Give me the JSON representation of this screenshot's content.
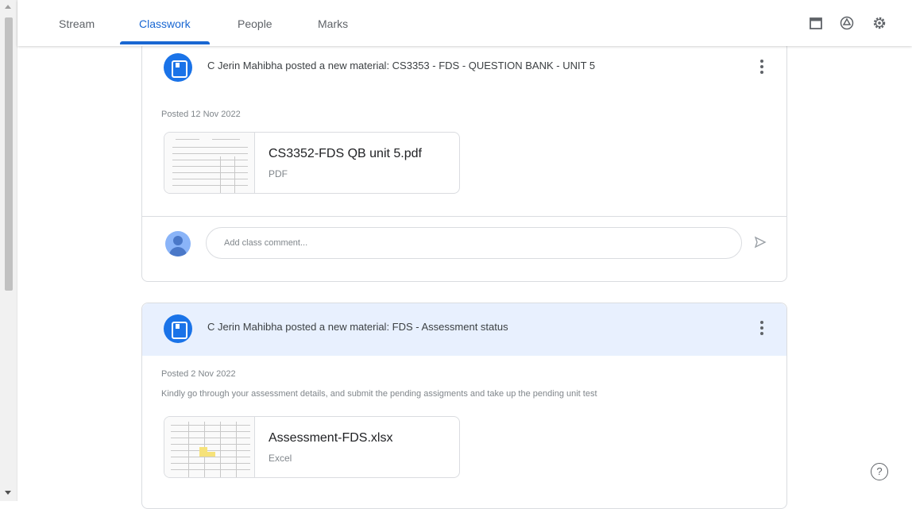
{
  "tabs": [
    {
      "label": "Stream"
    },
    {
      "label": "Classwork"
    },
    {
      "label": "People"
    },
    {
      "label": "Marks"
    }
  ],
  "active_tab": "Classwork",
  "top_icons": [
    "calendar-icon",
    "drive-icon",
    "settings-icon"
  ],
  "posts": [
    {
      "header": "C Jerin Mahibha posted a new material: CS3353 - FDS - QUESTION BANK - UNIT 5",
      "posted": "Posted 12 Nov 2022",
      "attachment": {
        "title": "CS3352-FDS QB unit 5.pdf",
        "type": "PDF"
      },
      "comment_placeholder": "Add class comment..."
    },
    {
      "header": "C Jerin Mahibha posted a new material: FDS - Assessment status",
      "posted": "Posted 2 Nov 2022",
      "description": "Kindly go through your assessment details, and submit the pending assigments and take up the pending unit test",
      "attachment": {
        "title": "Assessment-FDS.xlsx",
        "type": "Excel"
      }
    }
  ],
  "help_label": "?",
  "colors": {
    "accent": "#1967d2",
    "highlight": "#e8f0fe",
    "material_icon": "#1a73e8"
  }
}
